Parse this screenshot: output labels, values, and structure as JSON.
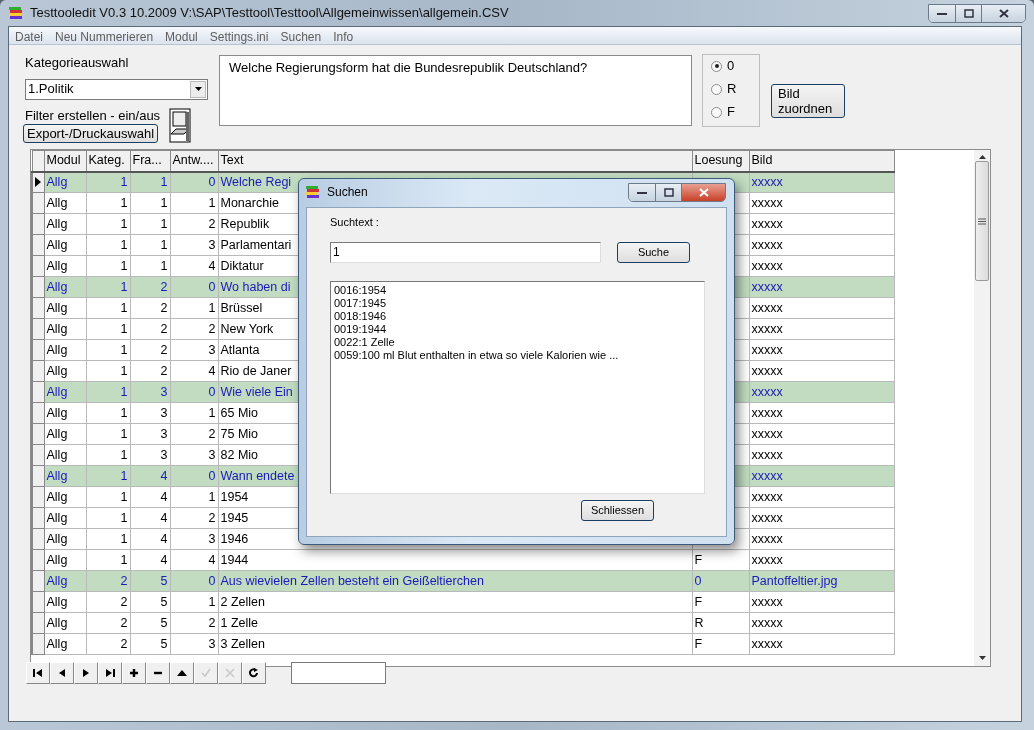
{
  "window": {
    "title": "Testtooledit V0.3 10.2009 V:\\SAP\\Testtool\\Testtool\\Allgemeinwissen\\allgemein.CSV"
  },
  "menu": [
    "Datei",
    "Neu Nummerieren",
    "Modul",
    "Settings.ini",
    "Suchen",
    "Info"
  ],
  "category": {
    "label": "Kategorieauswahl",
    "value": "1.Politik"
  },
  "filter_label": "Filter erstellen - ein/aus",
  "export_button": "Export-/Druckauswahl",
  "question_text": "Welche Regierungsform hat die Bundesrepublik Deutschland?",
  "answer_options": [
    {
      "label": "0",
      "selected": true
    },
    {
      "label": "R",
      "selected": false
    },
    {
      "label": "F",
      "selected": false
    }
  ],
  "assign_image_button": "Bild zuordnen",
  "table": {
    "columns": [
      "Modul",
      "Kateg.",
      "Fra...",
      "Antw....",
      "Text",
      "Loesung",
      "Bild"
    ],
    "rows": [
      {
        "current": true,
        "question": true,
        "cells": [
          "Allg",
          "1",
          "1",
          "0",
          "Welche Regi",
          null,
          "xxxxx"
        ]
      },
      {
        "current": false,
        "question": false,
        "cells": [
          "Allg",
          "1",
          "1",
          "1",
          "Monarchie",
          null,
          "xxxxx"
        ]
      },
      {
        "current": false,
        "question": false,
        "cells": [
          "Allg",
          "1",
          "1",
          "2",
          "Republik",
          null,
          "xxxxx"
        ]
      },
      {
        "current": false,
        "question": false,
        "cells": [
          "Allg",
          "1",
          "1",
          "3",
          "Parlamentari",
          null,
          "xxxxx"
        ]
      },
      {
        "current": false,
        "question": false,
        "cells": [
          "Allg",
          "1",
          "1",
          "4",
          "Diktatur",
          null,
          "xxxxx"
        ]
      },
      {
        "current": false,
        "question": true,
        "cells": [
          "Allg",
          "1",
          "2",
          "0",
          "Wo haben di",
          null,
          "xxxxx"
        ]
      },
      {
        "current": false,
        "question": false,
        "cells": [
          "Allg",
          "1",
          "2",
          "1",
          "Brüssel",
          null,
          "xxxxx"
        ]
      },
      {
        "current": false,
        "question": false,
        "cells": [
          "Allg",
          "1",
          "2",
          "2",
          "New York",
          null,
          "xxxxx"
        ]
      },
      {
        "current": false,
        "question": false,
        "cells": [
          "Allg",
          "1",
          "2",
          "3",
          "Atlanta",
          null,
          "xxxxx"
        ]
      },
      {
        "current": false,
        "question": false,
        "cells": [
          "Allg",
          "1",
          "2",
          "4",
          "Rio de Janer",
          null,
          "xxxxx"
        ]
      },
      {
        "current": false,
        "question": true,
        "cells": [
          "Allg",
          "1",
          "3",
          "0",
          "Wie viele Ein",
          null,
          "xxxxx"
        ]
      },
      {
        "current": false,
        "question": false,
        "cells": [
          "Allg",
          "1",
          "3",
          "1",
          "65 Mio",
          null,
          "xxxxx"
        ]
      },
      {
        "current": false,
        "question": false,
        "cells": [
          "Allg",
          "1",
          "3",
          "2",
          "75 Mio",
          null,
          "xxxxx"
        ]
      },
      {
        "current": false,
        "question": false,
        "cells": [
          "Allg",
          "1",
          "3",
          "3",
          "82 Mio",
          null,
          "xxxxx"
        ]
      },
      {
        "current": false,
        "question": true,
        "cells": [
          "Allg",
          "1",
          "4",
          "0",
          "Wann endete",
          null,
          "xxxxx"
        ]
      },
      {
        "current": false,
        "question": false,
        "cells": [
          "Allg",
          "1",
          "4",
          "1",
          "1954",
          null,
          "xxxxx"
        ]
      },
      {
        "current": false,
        "question": false,
        "cells": [
          "Allg",
          "1",
          "4",
          "2",
          "1945",
          null,
          "xxxxx"
        ]
      },
      {
        "current": false,
        "question": false,
        "cells": [
          "Allg",
          "1",
          "4",
          "3",
          "1946",
          null,
          "xxxxx"
        ]
      },
      {
        "current": false,
        "question": false,
        "cells": [
          "Allg",
          "1",
          "4",
          "4",
          "1944",
          "F",
          "xxxxx"
        ]
      },
      {
        "current": false,
        "question": true,
        "cells": [
          "Allg",
          "2",
          "5",
          "0",
          "Aus wievielen Zellen besteht ein Geißeltierchen",
          "0",
          "Pantoffeltier.jpg"
        ]
      },
      {
        "current": false,
        "question": false,
        "cells": [
          "Allg",
          "2",
          "5",
          "1",
          "2 Zellen",
          "F",
          "xxxxx"
        ]
      },
      {
        "current": false,
        "question": false,
        "cells": [
          "Allg",
          "2",
          "5",
          "2",
          "1 Zelle",
          "R",
          "xxxxx"
        ]
      },
      {
        "current": false,
        "question": false,
        "cells": [
          "Allg",
          "2",
          "5",
          "3",
          "3 Zellen",
          "F",
          "xxxxx"
        ]
      }
    ]
  },
  "navigator": [
    {
      "kind": "first",
      "disabled": false
    },
    {
      "kind": "prev",
      "disabled": false
    },
    {
      "kind": "next",
      "disabled": false
    },
    {
      "kind": "last",
      "disabled": false
    },
    {
      "kind": "add",
      "disabled": false
    },
    {
      "kind": "delete",
      "disabled": false
    },
    {
      "kind": "edit",
      "disabled": false
    },
    {
      "kind": "post",
      "disabled": true
    },
    {
      "kind": "cancel",
      "disabled": true
    },
    {
      "kind": "refresh",
      "disabled": false
    }
  ],
  "dialog": {
    "title": "Suchen",
    "label": "Suchtext :",
    "value": "1",
    "search_button": "Suche",
    "results": [
      "0016:1954",
      "0017:1945",
      "0018:1946",
      "0019:1944",
      "0022:1 Zelle",
      "0059:100 ml Blut enthalten in etwa so viele Kalorien wie ..."
    ],
    "close_button": "Schliessen"
  }
}
